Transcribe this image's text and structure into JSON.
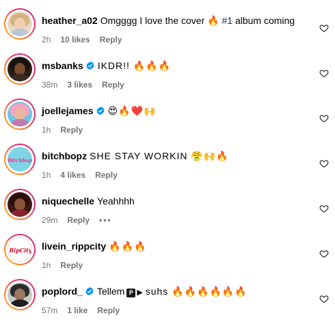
{
  "colors": {
    "text_primary": "#000000",
    "text_secondary": "#737373",
    "verified_badge": "#0095f6",
    "hashtag": "#00376b",
    "story_ring": [
      "#fdbb2d",
      "#e1306c",
      "#c13584"
    ]
  },
  "icons": {
    "like": "heart-outline-icon",
    "verified": "verified-badge-icon",
    "more": "more-dots-icon"
  },
  "comments": [
    {
      "username": "heather_a02",
      "text_before": "Omgggg I love the cover 🔥",
      "hashtag": "#1",
      "text_after": "album coming",
      "time": "2h",
      "likes": "10 likes",
      "reply": "Reply"
    },
    {
      "username": "msbanks",
      "text": "IKDR!! 🔥🔥🔥",
      "time": "38m",
      "likes": "3 likes",
      "reply": "Reply"
    },
    {
      "username": "joellejames",
      "text": "😍🔥❤️🙌",
      "time": "1h",
      "reply": "Reply"
    },
    {
      "username": "bitchbopz",
      "text": "SHE STAY WORKIN 😤🙌🔥",
      "time": "1h",
      "likes": "4 likes",
      "reply": "Reply",
      "avatar_text": "Bitchbopz"
    },
    {
      "username": "niquechelle",
      "text": "Yeahhhh",
      "time": "29m",
      "reply": "Reply",
      "more": "•••"
    },
    {
      "username": "livein_rippcity",
      "text": "🔥🔥🔥",
      "time": "1h",
      "reply": "Reply",
      "avatar_text": "RipCity"
    },
    {
      "username": "poplord_",
      "text_before": "Tellem",
      "pbox": "P",
      "play": "▶",
      "text_after": "suhs 🔥🔥🔥🔥🔥🔥",
      "time": "57m",
      "likes": "1 like",
      "reply": "Reply"
    }
  ]
}
